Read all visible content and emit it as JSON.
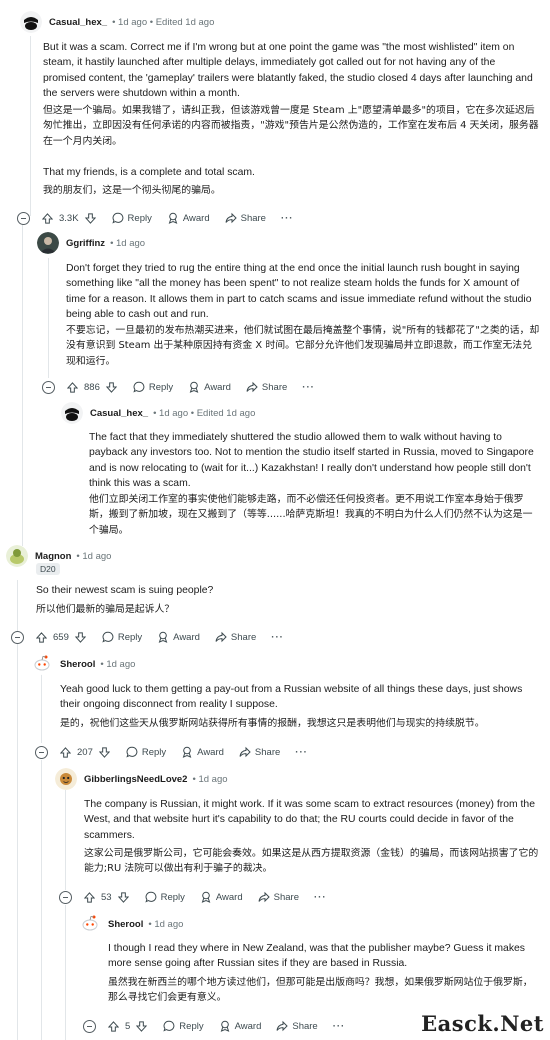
{
  "comments": [
    {
      "user": "Casual_hex_",
      "meta": "• 1d ago • Edited 1d ago",
      "body_en": "But it was a scam. Correct me if I'm wrong but at one point the game was \"the most wishlisted\" item on steam, it hastily launched after multiple delays, immediately got called out for not having any of the promised content, the 'gameplay' trailers were blatantly faked, the studio closed 4 days after launching and the servers were shutdown within a month.",
      "body_zh": "但这是一个骗局。如果我错了，请纠正我，但该游戏曾一度是 Steam 上\"愿望清单最多\"的项目，它在多次延迟后匆忙推出，立即因没有任何承诺的内容而被指责，\"游戏\"预告片是公然伪造的，工作室在发布后 4 天关闭，服务器在一个月内关闭。",
      "body2_en": "That my friends, is a complete and total scam.",
      "body2_zh": "我的朋友们，这是一个彻头彻尾的骗局。",
      "votes": "3.3K",
      "reply": "Reply",
      "award": "Award",
      "share": "Share",
      "more": "···"
    },
    {
      "user": "Ggriffinz",
      "meta": "• 1d ago",
      "body_en": "Don't forget they tried to rug the entire thing at the end once the initial launch rush bought in saying something like \"all the money has been spent\" to not realize steam holds the funds for X amount of time for a reason. It allows them in part to catch scams and issue immediate refund without the studio being able to cash out and run.",
      "body_zh": "不要忘记，一旦最初的发布热潮买进来，他们就试图在最后掩盖整个事情，说\"所有的钱都花了\"之类的话，却没有意识到 Steam 出于某种原因持有资金 X 时间。它部分允许他们发现骗局并立即退款，而工作室无法兑现和运行。",
      "votes": "886",
      "reply": "Reply",
      "award": "Award",
      "share": "Share",
      "more": "···"
    },
    {
      "user": "Casual_hex_",
      "meta": "• 1d ago • Edited 1d ago",
      "body_en": "The fact that they immediately shuttered the studio allowed them to walk without having to payback any investors too. Not to mention the studio itself started in Russia, moved to Singapore and is now relocating to (wait for it...) Kazakhstan! I really don't understand how people still don't think this was a scam.",
      "body_zh": "他们立即关闭工作室的事实使他们能够走路，而不必偿还任何投资者。更不用说工作室本身始于俄罗斯，搬到了新加坡，现在又搬到了（等等......哈萨克斯坦！我真的不明白为什么人们仍然不认为这是一个骗局。"
    },
    {
      "user": "Magnon",
      "meta": "• 1d ago",
      "flair": "D20",
      "body_en": "So their newest scam is suing people?",
      "body_zh": "所以他们最新的骗局是起诉人？",
      "votes": "659",
      "reply": "Reply",
      "award": "Award",
      "share": "Share",
      "more": "···"
    },
    {
      "user": "Sherool",
      "meta": "• 1d ago",
      "body_en": "Yeah good luck to them getting a pay-out from a Russian website of all things these days, just shows their ongoing disconnect from reality I suppose.",
      "body_zh": "是的，祝他们这些天从俄罗斯网站获得所有事情的报酬，我想这只是表明他们与现实的持续脱节。",
      "votes": "207",
      "reply": "Reply",
      "award": "Award",
      "share": "Share",
      "more": "···"
    },
    {
      "user": "GibberlingsNeedLove2",
      "meta": "• 1d ago",
      "body_en": "The company is Russian, it might work. If it was some scam to extract resources (money) from the West, and that website hurt it's capability to do that; the RU courts could decide in favor of the scammers.",
      "body_zh": "这家公司是俄罗斯公司，它可能会奏效。如果这是从西方提取资源（金钱）的骗局，而该网站损害了它的能力;RU 法院可以做出有利于骗子的裁决。",
      "votes": "53",
      "reply": "Reply",
      "award": "Award",
      "share": "Share",
      "more": "···"
    },
    {
      "user": "Sherool",
      "meta": "• 1d ago",
      "body_en": "I though I read they where in New Zealand, was that the publisher maybe? Guess it makes more sense going after Russian sites if they are based in Russia.",
      "body_zh": "虽然我在新西兰的哪个地方读过他们，但那可能是出版商吗？我想，如果俄罗斯网站位于俄罗斯，那么寻找它们会更有意义。",
      "votes": "5",
      "reply": "Reply",
      "award": "Award",
      "share": "Share",
      "more": "···"
    }
  ],
  "watermark": "Easck.Net",
  "colors": {
    "text": "#1c1c1c",
    "meta": "#6a7579",
    "thread_line": "#e2e6e9",
    "snoo_orange": "#ff4500"
  }
}
